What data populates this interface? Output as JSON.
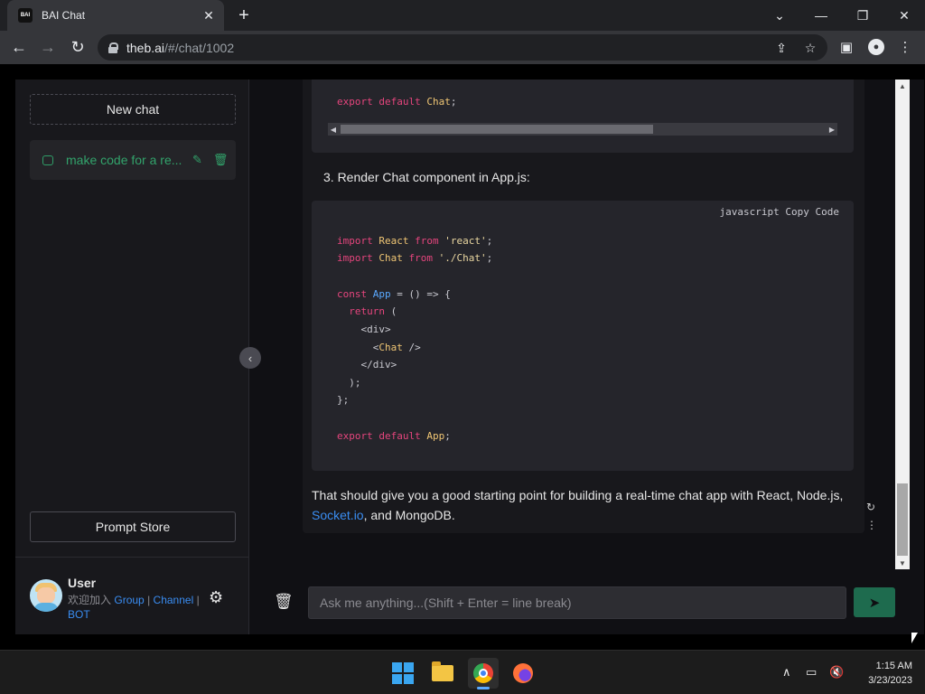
{
  "browser": {
    "tab_title": "BAI Chat",
    "favicon_text": "BAI",
    "url_host": "theb.ai",
    "url_path": "/#/chat/1002"
  },
  "sidebar": {
    "new_chat_label": "New chat",
    "chat_items": [
      {
        "title": "make code for a re..."
      }
    ],
    "prompt_store_label": "Prompt Store",
    "user": {
      "name": "User",
      "subtitle_prefix": "欢迎加入",
      "group_link": "Group",
      "separator": "|",
      "channel_link": "Channel",
      "bot_link": "BOT"
    }
  },
  "chat": {
    "code_block_1": {
      "lines": [
        "export default Chat;"
      ]
    },
    "step3_text": "3. Render Chat component in App.js:",
    "code_block_2": {
      "language": "javascript",
      "copy_label": "Copy Code"
    },
    "final_text_before": "That should give you a good starting point for building a real-time chat app with React, Node.js,",
    "final_link": "Socket.io",
    "final_text_after": ", and MongoDB.",
    "input_placeholder": "Ask me anything...(Shift + Enter = line break)"
  },
  "taskbar": {
    "time": "1:15 AM",
    "date": "3/23/2023"
  },
  "colors": {
    "accent_green": "#32a36b",
    "link_blue": "#3a8df2",
    "keyword_pink": "#e5457d",
    "send_button": "#1e6b4e"
  }
}
